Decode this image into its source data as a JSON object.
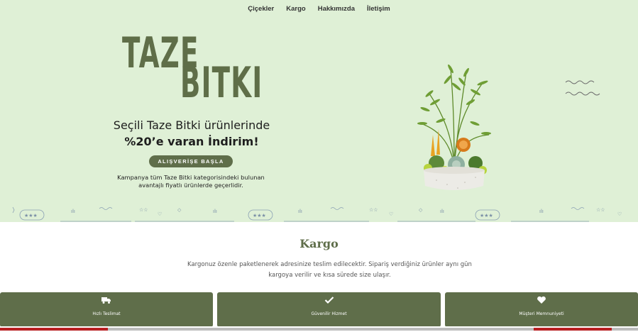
{
  "nav": {
    "items": [
      "Çiçekler",
      "Kargo",
      "Hakkımızda",
      "İletişim"
    ]
  },
  "hero": {
    "title_line1": "TAZE",
    "title_line2": "BITKI",
    "subtitle_line1": "Seçili Taze Bitki ürünlerinde",
    "subtitle_line2": "%20’e varan İndirim!",
    "cta_label": "ALIŞVERİŞE BAŞLA",
    "note": "Kampanya tüm Taze Bitki kategorisindeki bulunan avantajlı fiyatlı ürünlerde geçerlidir."
  },
  "kargo": {
    "title": "Kargo",
    "description": "Kargonuz özenle paketlenerek adresinize teslim edilecektir. Sipariş verdiğiniz ürünler aynı gün kargoya verilir ve kısa sürede size ulaşır."
  },
  "features": [
    {
      "label": "Hızlı Teslimat",
      "icon": "truck-icon"
    },
    {
      "label": "Güvenilir Hizmet",
      "icon": "check-icon"
    },
    {
      "label": "Müşteri Memnuniyeti",
      "icon": "heart-icon"
    }
  ],
  "colors": {
    "hero_bg": "#dff0d6",
    "accent": "#5f6e4a",
    "text_dark": "#1e1e1e"
  }
}
